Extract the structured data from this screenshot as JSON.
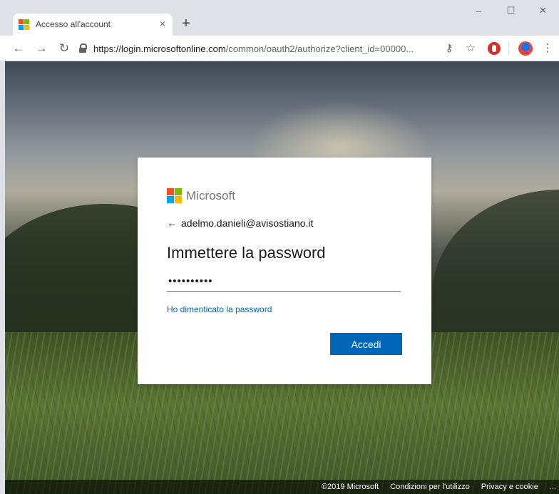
{
  "browser": {
    "tab_title": "Accesso all'account",
    "tab_close": "×",
    "new_tab": "+",
    "window_controls": {
      "minimize": "–",
      "maximize": "☐",
      "close": "✕"
    },
    "url_host": "https://login.microsoftonline.com",
    "url_path": "/common/oauth2/authorize?client_id=00000...",
    "toolbar_icons": [
      "back-icon",
      "forward-icon",
      "reload-icon",
      "lock-icon",
      "key-icon",
      "star-icon",
      "adblock-icon",
      "extension-icon",
      "menu-icon"
    ]
  },
  "login": {
    "brand": "Microsoft",
    "identity": "adelmo.danieli@avisostiano.it",
    "back_arrow": "←",
    "heading": "Immettere la password",
    "password_value": "••••••••••",
    "forgot_link": "Ho dimenticato la password",
    "submit_label": "Accedi"
  },
  "footer": {
    "copyright": "©2019 Microsoft",
    "terms": "Condizioni per l'utilizzo",
    "privacy": "Privacy e cookie",
    "more": "..."
  },
  "colors": {
    "accent": "#0067b8",
    "ms_red": "#f25022",
    "ms_green": "#7fba00",
    "ms_blue": "#00a4ef",
    "ms_yellow": "#ffb900"
  }
}
